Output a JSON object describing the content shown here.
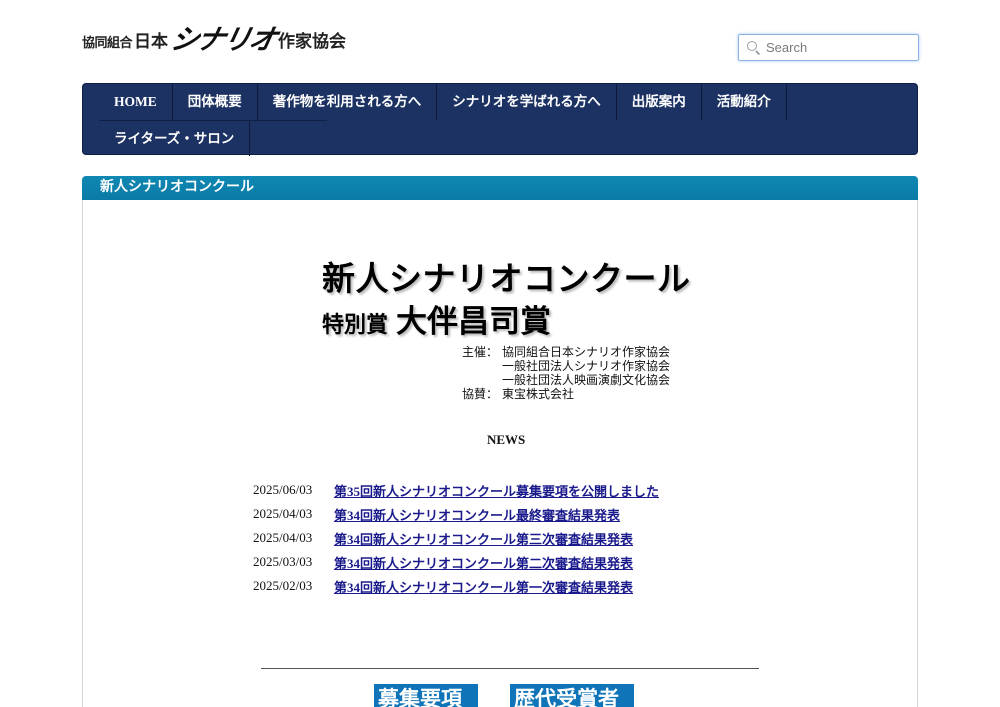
{
  "header": {
    "logo_prefix": "協同組合",
    "logo_mid": "日本",
    "logo_main": "シナリオ",
    "logo_suffix": "作家協会"
  },
  "search": {
    "placeholder": "Search"
  },
  "nav": {
    "row1": [
      "HOME",
      "団体概要",
      "著作物を利用される方へ",
      "シナリオを学ばれる方へ",
      "出版案内",
      "活動紹介"
    ],
    "row2": [
      "ライターズ・サロン"
    ]
  },
  "section": {
    "title": "新人シナリオコンクール"
  },
  "hero": {
    "title": "新人シナリオコンクール",
    "sub_small": "特別賞",
    "sub_large": "大伴昌司賞"
  },
  "sponsors": {
    "host_label": "主催：",
    "hosts": [
      "協同組合日本シナリオ作家協会",
      "一般社団法人シナリオ作家協会",
      "一般社団法人映画演劇文化協会"
    ],
    "support_label": "協賛：",
    "support": "東宝株式会社"
  },
  "news": {
    "title": "NEWS",
    "items": [
      {
        "date": "2025/06/03",
        "text": "第35回新人シナリオコンクール募集要項を公開しました"
      },
      {
        "date": "2025/04/03",
        "text": "第34回新人シナリオコンクール最終審査結果発表"
      },
      {
        "date": "2025/04/03",
        "text": "第34回新人シナリオコンクール第三次審査結果発表"
      },
      {
        "date": "2025/03/03",
        "text": "第34回新人シナリオコンクール第二次審査結果発表"
      },
      {
        "date": "2025/02/03",
        "text": "第34回新人シナリオコンクール第一次審査結果発表"
      }
    ]
  },
  "banners": [
    "募集要項",
    "歴代受賞者"
  ]
}
